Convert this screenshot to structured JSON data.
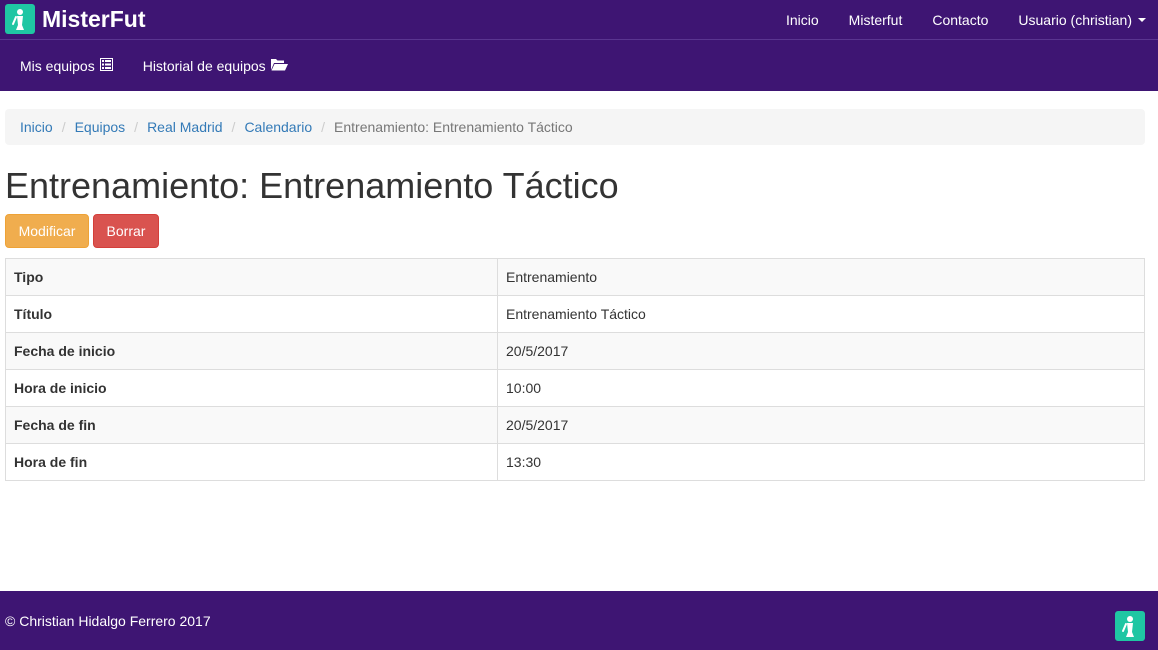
{
  "brand": {
    "name": "MisterFut"
  },
  "topnav": {
    "items": [
      {
        "label": "Inicio"
      },
      {
        "label": "Misterfut"
      },
      {
        "label": "Contacto"
      },
      {
        "label": "Usuario (christian)"
      }
    ]
  },
  "subnav": {
    "items": [
      {
        "label": "Mis equipos",
        "icon": "list-icon"
      },
      {
        "label": "Historial de equipos",
        "icon": "folder-open-icon"
      }
    ]
  },
  "breadcrumb": {
    "items": [
      "Inicio",
      "Equipos",
      "Real Madrid",
      "Calendario"
    ],
    "active": "Entrenamiento: Entrenamiento Táctico"
  },
  "page": {
    "title": "Entrenamiento: Entrenamiento Táctico",
    "modify_label": "Modificar",
    "delete_label": "Borrar"
  },
  "details": {
    "rows": [
      {
        "key": "Tipo",
        "value": "Entrenamiento"
      },
      {
        "key": "Título",
        "value": "Entrenamiento Táctico"
      },
      {
        "key": "Fecha de inicio",
        "value": "20/5/2017"
      },
      {
        "key": "Hora de inicio",
        "value": "10:00"
      },
      {
        "key": "Fecha de fin",
        "value": "20/5/2017"
      },
      {
        "key": "Hora de fin",
        "value": "13:30"
      }
    ]
  },
  "footer": {
    "copyright": "© Christian Hidalgo Ferrero 2017"
  },
  "colors": {
    "navbar": "#3e1573",
    "logo": "#1fc6a3",
    "link": "#337ab7",
    "warning": "#f0ad4e",
    "danger": "#d9534f"
  }
}
